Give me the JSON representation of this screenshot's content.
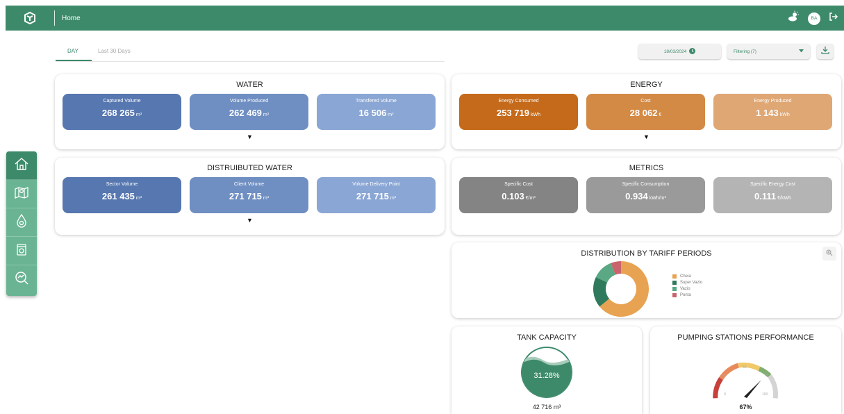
{
  "header": {
    "title": "Home",
    "avatar_initials": "BA",
    "accent": "#3d8a6a"
  },
  "tabs": [
    {
      "label": "DAY"
    },
    {
      "label": "Last 30 Days"
    }
  ],
  "toolbar": {
    "date": "18/03/2024",
    "filter": "Filtering (7)"
  },
  "water": {
    "title": "WATER",
    "cards": [
      {
        "label": "Captured Volume",
        "value": "268 265",
        "unit": "m³"
      },
      {
        "label": "Volume Produced",
        "value": "262 469",
        "unit": "m³"
      },
      {
        "label": "Transfered Volume",
        "value": "16 506",
        "unit": "m³"
      }
    ]
  },
  "energy": {
    "title": "ENERGY",
    "cards": [
      {
        "label": "Energy Consumed",
        "value": "253 719",
        "unit": "kWh"
      },
      {
        "label": "Cost",
        "value": "28 062",
        "unit": "€"
      },
      {
        "label": "Energy Produced",
        "value": "1 143",
        "unit": "kWh"
      }
    ]
  },
  "distributed": {
    "title": "DISTRUIBUTED WATER",
    "cards": [
      {
        "label": "Sector Volume",
        "value": "261 435",
        "unit": "m³"
      },
      {
        "label": "Client Volume",
        "value": "271 715",
        "unit": "m³"
      },
      {
        "label": "Volume Delivery Point",
        "value": "271 715",
        "unit": "m³"
      }
    ]
  },
  "metrics": {
    "title": "METRICS",
    "cards": [
      {
        "label": "Specific Cost",
        "value": "0.103",
        "unit": "€/m³"
      },
      {
        "label": "Specific Consumption",
        "value": "0.934",
        "unit": "kWh/m³"
      },
      {
        "label": "Specific Energy Cost",
        "value": "0.111",
        "unit": "€/kWh"
      }
    ]
  },
  "tariff": {
    "title": "DISTRIBUTION BY TARIFF PERIODS",
    "legend": [
      {
        "name": "Cheia",
        "color": "#e8a352"
      },
      {
        "name": "Super Vazio",
        "color": "#2f7a5c"
      },
      {
        "name": "Vazio",
        "color": "#5aa884"
      },
      {
        "name": "Ponta",
        "color": "#c9646c"
      }
    ]
  },
  "tank": {
    "title": "TANK CAPACITY",
    "percent_label": "31.28%",
    "volume": "42 716 m³"
  },
  "pumping": {
    "title": "PUMPING STATIONS PERFORMANCE",
    "value_label": "67%",
    "ticks": [
      "0",
      "25",
      "50",
      "75",
      "100"
    ]
  },
  "chart_data": {
    "type": "pie",
    "title": "DISTRIBUTION BY TARIFF PERIODS",
    "categories": [
      "Cheia",
      "Super Vazio",
      "Vazio",
      "Ponta"
    ],
    "values": [
      64,
      18,
      12,
      6
    ]
  }
}
